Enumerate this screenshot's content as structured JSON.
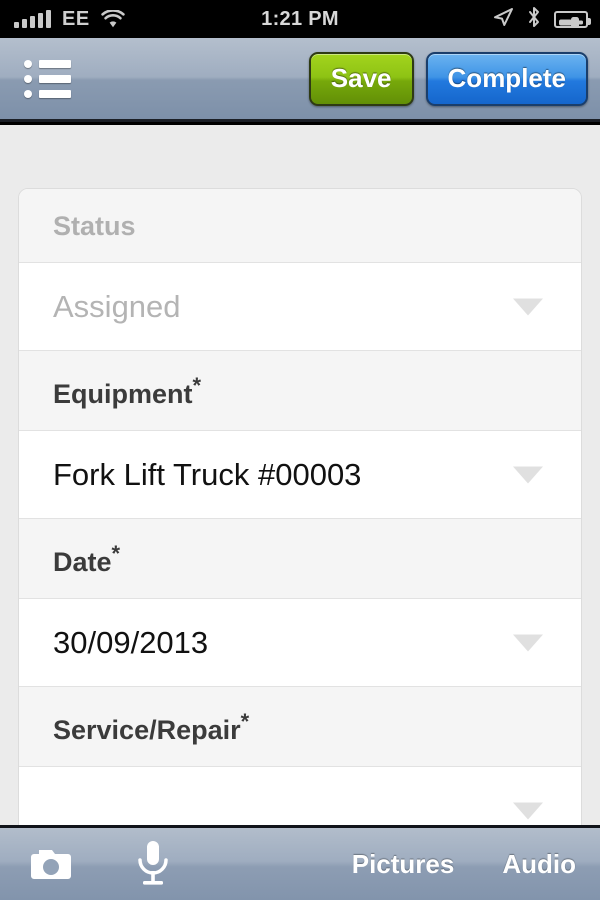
{
  "status_bar": {
    "carrier": "EE",
    "time": "1:21 PM",
    "signal_bars": 5,
    "icons": [
      "signal-bars-icon",
      "wifi-icon",
      "location-arrow-icon",
      "bluetooth-icon",
      "battery-charging-icon"
    ]
  },
  "navbar": {
    "menu_icon": "bulleted-list-menu-icon",
    "save_label": "Save",
    "complete_label": "Complete",
    "save_color": "#8ec314",
    "complete_color": "#2279de"
  },
  "form": {
    "fields": [
      {
        "label": "Status",
        "required": false,
        "value": "Assigned",
        "muted": true,
        "has_caret": true
      },
      {
        "label": "Equipment",
        "required": true,
        "value": "Fork Lift Truck #00003",
        "muted": false,
        "has_caret": true
      },
      {
        "label": "Date",
        "required": true,
        "value": "30/09/2013",
        "muted": false,
        "has_caret": true
      },
      {
        "label": "Service/Repair",
        "required": true,
        "value": "",
        "muted": false,
        "has_caret": true
      }
    ],
    "required_marker": "*"
  },
  "toolbar": {
    "camera_icon": "camera-icon",
    "mic_icon": "microphone-icon",
    "pictures_label": "Pictures",
    "audio_label": "Audio"
  }
}
